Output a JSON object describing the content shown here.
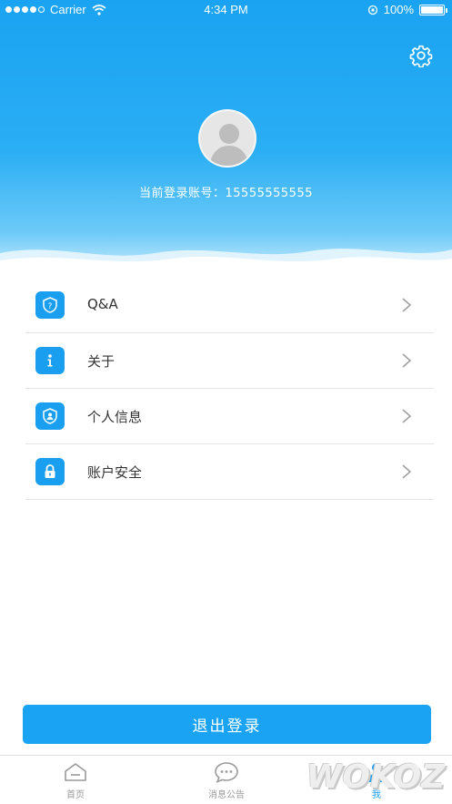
{
  "status_bar": {
    "carrier": "Carrier",
    "time": "4:34 PM",
    "battery": "100%"
  },
  "profile": {
    "account_label": "当前登录账号：",
    "account_number": "15555555555"
  },
  "menu": [
    {
      "label": "Q&A",
      "icon": "question-shield-icon"
    },
    {
      "label": "关于",
      "icon": "info-icon"
    },
    {
      "label": "个人信息",
      "icon": "user-shield-icon"
    },
    {
      "label": "账户安全",
      "icon": "lock-icon"
    }
  ],
  "logout_label": "退出登录",
  "tabs": [
    {
      "label": "首页",
      "icon": "home-icon"
    },
    {
      "label": "消息公告",
      "icon": "message-icon"
    },
    {
      "label": "我",
      "icon": "user-icon"
    }
  ],
  "watermark": "WOKOZ",
  "colors": {
    "accent": "#1aa3f2",
    "text": "#333333",
    "tab_inactive": "#9a9a9a"
  }
}
